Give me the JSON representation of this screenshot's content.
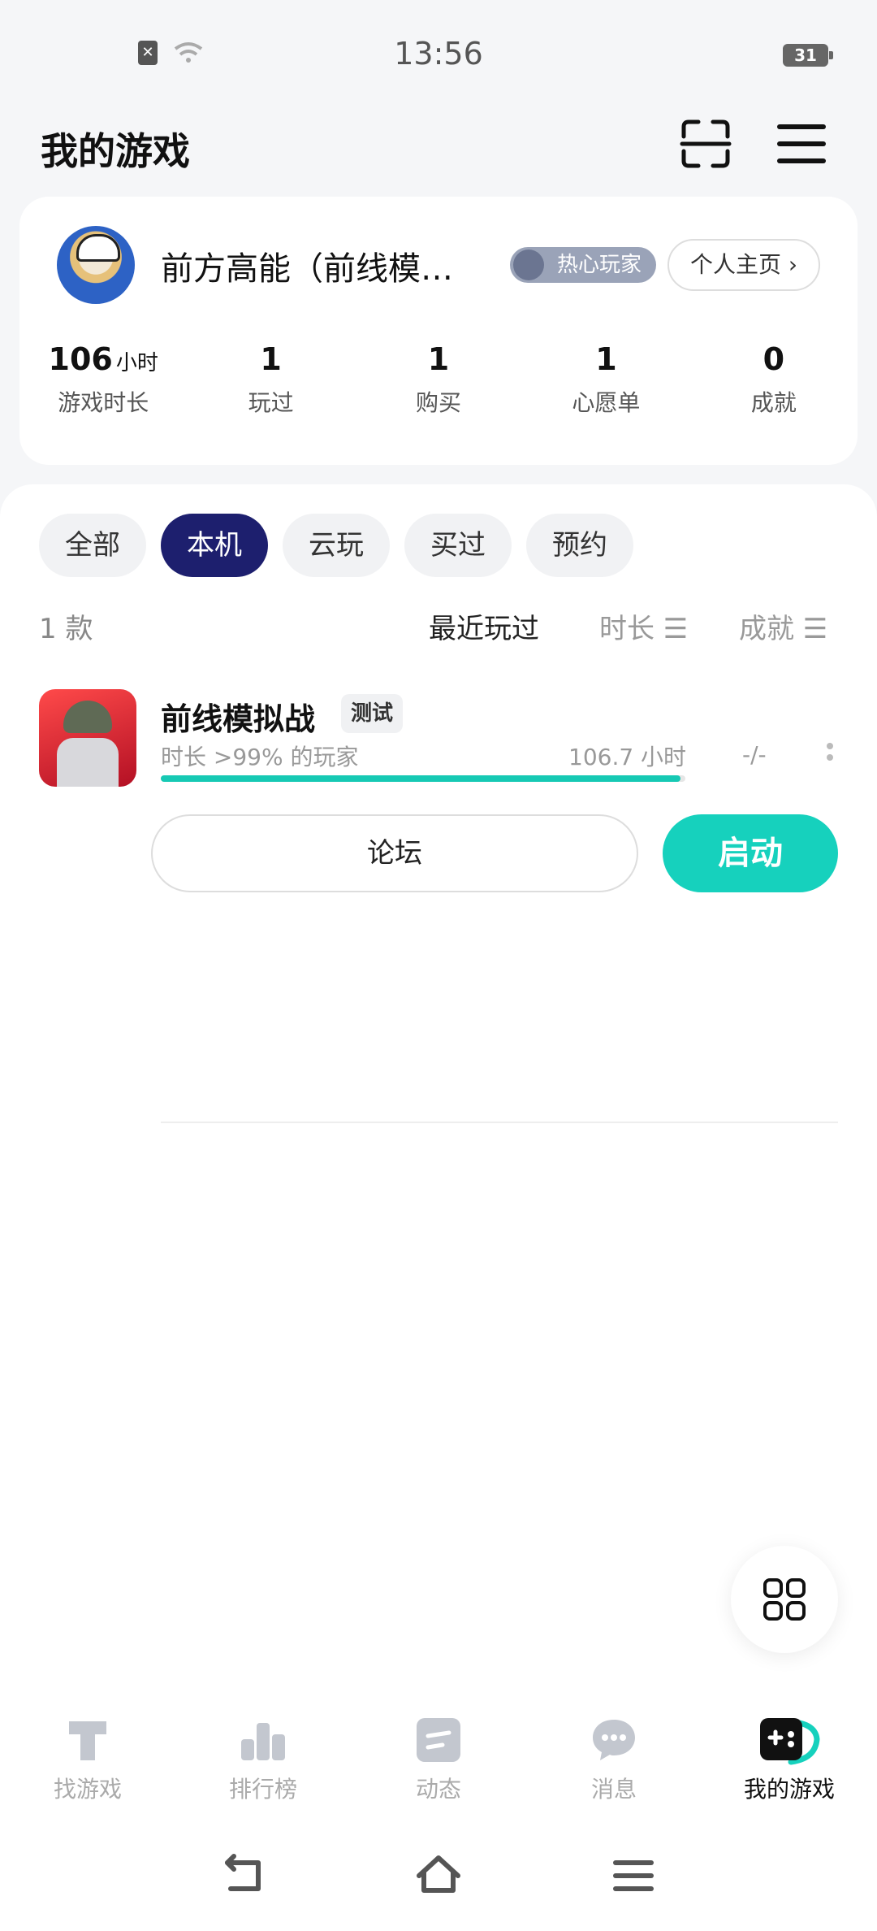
{
  "status_bar": {
    "time": "13:56",
    "battery": "31"
  },
  "header": {
    "title": "我的游戏"
  },
  "profile": {
    "username": "前方高能（前线模…",
    "badge": "热心玩家",
    "homepage_button": "个人主页 ›",
    "stats": [
      {
        "value": "106",
        "unit": "小时",
        "label": "游戏时长"
      },
      {
        "value": "1",
        "unit": "",
        "label": "玩过"
      },
      {
        "value": "1",
        "unit": "",
        "label": "购买"
      },
      {
        "value": "1",
        "unit": "",
        "label": "心愿单"
      },
      {
        "value": "0",
        "unit": "",
        "label": "成就"
      }
    ]
  },
  "filters": [
    "全部",
    "本机",
    "云玩",
    "买过",
    "预约"
  ],
  "active_filter": "本机",
  "list": {
    "count": "1 款",
    "sort_recent": "最近玩过",
    "sort_duration": "时长 ☰",
    "sort_achievement": "成就 ☰"
  },
  "game": {
    "name": "前线模拟战",
    "tag": "测试",
    "playtime_rank": "时长 >99% 的玩家",
    "hours": "106.7 小时",
    "achievements": "-/-",
    "progress": 0.99,
    "forum_button": "论坛",
    "launch_button": "启动"
  },
  "tabbar": {
    "items": [
      {
        "label": "找游戏",
        "icon": "discover-icon"
      },
      {
        "label": "排行榜",
        "icon": "ranking-icon"
      },
      {
        "label": "动态",
        "icon": "feed-icon"
      },
      {
        "label": "消息",
        "icon": "message-icon"
      },
      {
        "label": "我的游戏",
        "icon": "my-games-icon"
      }
    ]
  },
  "colors": {
    "accent": "#16d1bd",
    "active_chip": "#1d1f6e"
  }
}
